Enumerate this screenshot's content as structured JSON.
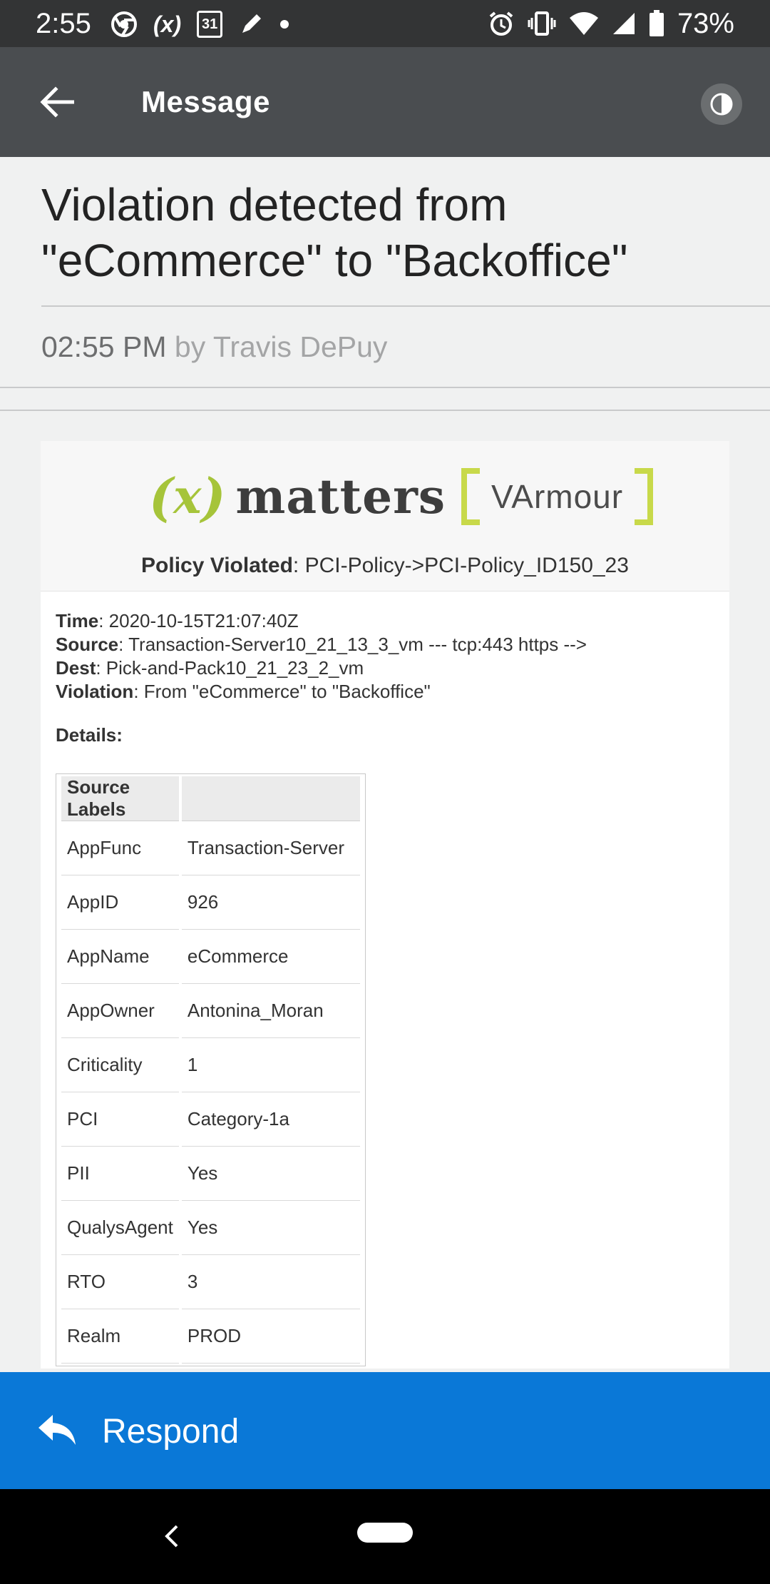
{
  "status_bar": {
    "time": "2:55",
    "battery_percent": "73%",
    "left_icons": [
      "chrome-icon",
      "xmatters-notification-icon",
      "calendar-31-icon",
      "pen-icon",
      "dot-icon"
    ],
    "right_icons": [
      "alarm-icon",
      "vibrate-icon",
      "wifi-icon",
      "signal-icon",
      "battery-icon"
    ],
    "calendar_day": "31",
    "xm_short": "(x)"
  },
  "app_bar": {
    "title": "Message"
  },
  "message": {
    "title": "Violation detected from \"eCommerce\" to \"Backoffice\"",
    "time": "02:55 PM",
    "by": "by Travis DePuy"
  },
  "logo": {
    "xm_open": "(",
    "xm_x": "x",
    "xm_close": ")",
    "xm_word": "matters",
    "varmour": "VArmour"
  },
  "policy": {
    "label": "Policy Violated",
    "value": ": PCI-Policy->PCI-Policy_ID150_23"
  },
  "fields": [
    {
      "label": "Time",
      "value": ": 2020-10-15T21:07:40Z"
    },
    {
      "label": "Source",
      "value": ": Transaction-Server10_21_13_3_vm --- tcp:443 https -->"
    },
    {
      "label": "Dest",
      "value": ": Pick-and-Pack10_21_23_2_vm"
    },
    {
      "label": "Violation",
      "value": ": From \"eCommerce\" to \"Backoffice\""
    }
  ],
  "details_label": "Details:",
  "source_labels_table": {
    "headers": [
      "Source Labels",
      ""
    ],
    "rows": [
      [
        "AppFunc",
        "Transaction-Server"
      ],
      [
        "AppID",
        "926"
      ],
      [
        "AppName",
        "eCommerce"
      ],
      [
        "AppOwner",
        "Antonina_Moran"
      ],
      [
        "Criticality",
        "1"
      ],
      [
        "PCI",
        "Category-1a"
      ],
      [
        "PII",
        "Yes"
      ],
      [
        "QualysAgent",
        "Yes"
      ],
      [
        "RTO",
        "3"
      ],
      [
        "Realm",
        "PROD"
      ]
    ]
  },
  "respond": {
    "label": "Respond"
  },
  "colors": {
    "status_bar": "#333435",
    "app_bar": "#4a4d50",
    "respond_bar": "#0a78d7",
    "xmatters_green": "#a6c43a",
    "varmour_bracket": "#c8d94a"
  }
}
